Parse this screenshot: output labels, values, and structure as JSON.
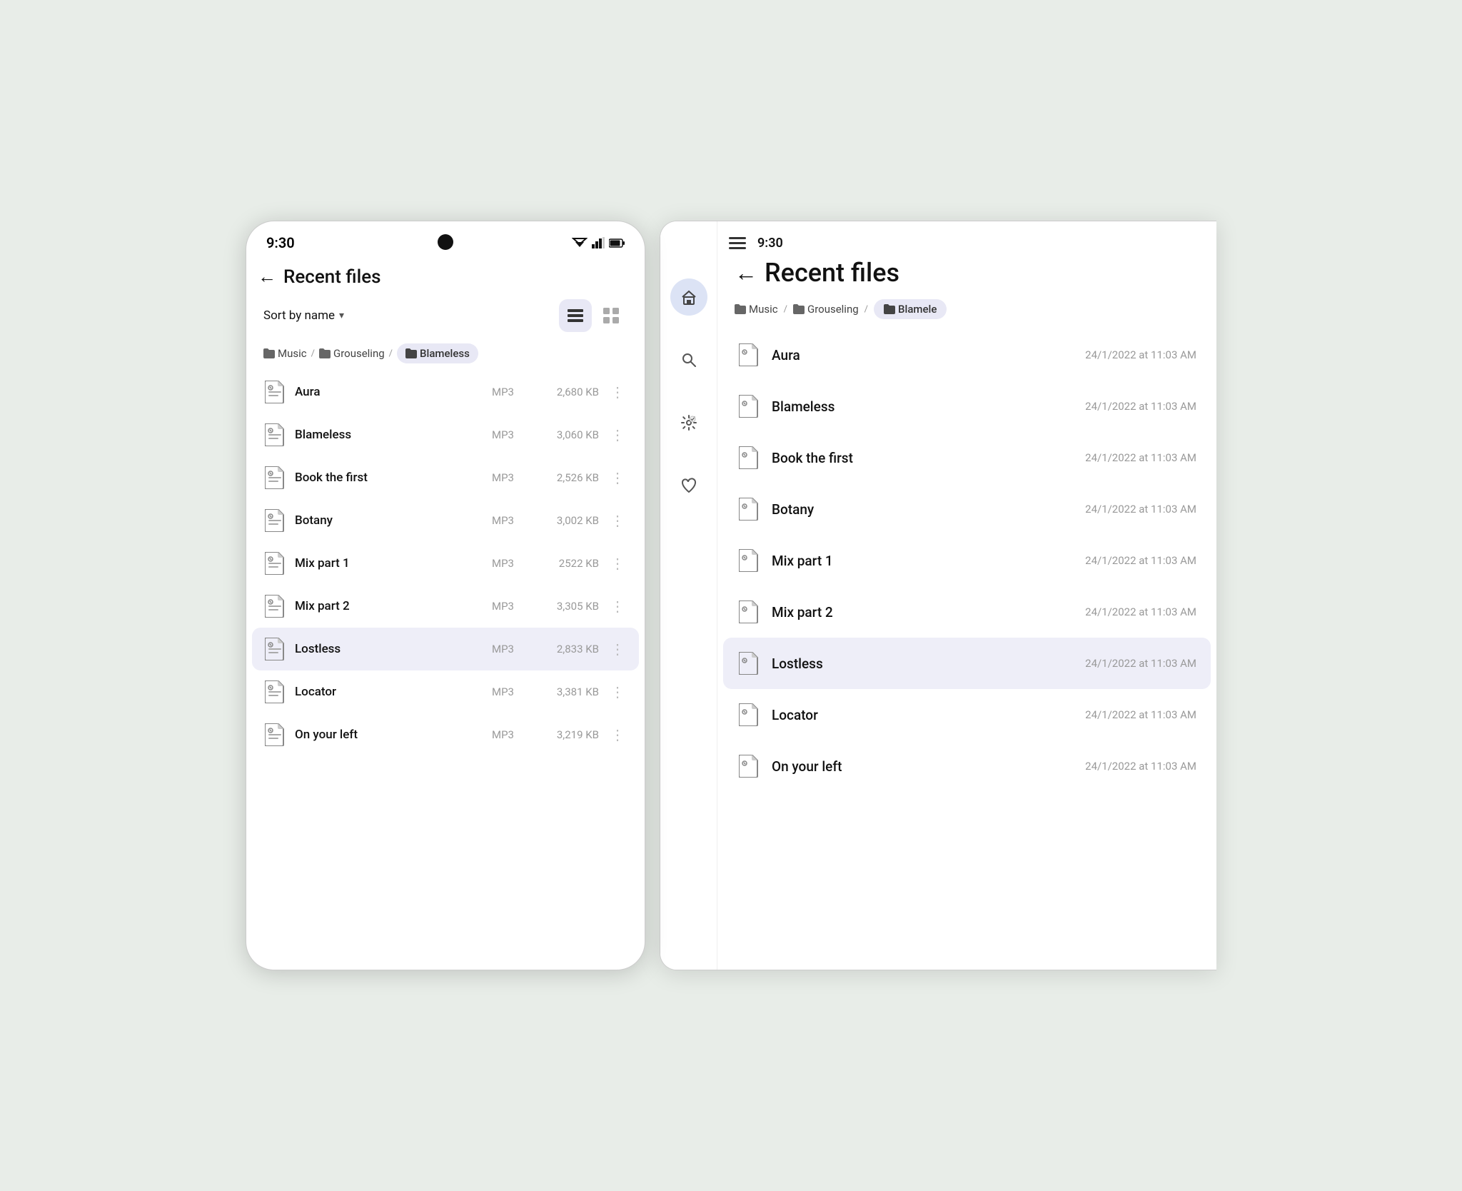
{
  "left_phone": {
    "status_time": "9:30",
    "title": "Recent files",
    "back_label": "←",
    "sort_label": "Sort by name",
    "view_list_active": true,
    "breadcrumbs": [
      {
        "label": "Music",
        "icon": "folder"
      },
      {
        "label": "Grouseling",
        "icon": "folder"
      },
      {
        "label": "Blameless",
        "icon": "folder",
        "active": true
      }
    ],
    "files": [
      {
        "name": "Aura",
        "type": "MP3",
        "size": "2,680 KB",
        "selected": false
      },
      {
        "name": "Blameless",
        "type": "MP3",
        "size": "3,060 KB",
        "selected": false
      },
      {
        "name": "Book the first",
        "type": "MP3",
        "size": "2,526 KB",
        "selected": false
      },
      {
        "name": "Botany",
        "type": "MP3",
        "size": "3,002 KB",
        "selected": false
      },
      {
        "name": "Mix part 1",
        "type": "MP3",
        "size": "2522 KB",
        "selected": false
      },
      {
        "name": "Mix part 2",
        "type": "MP3",
        "size": "3,305 KB",
        "selected": false
      },
      {
        "name": "Lostless",
        "type": "MP3",
        "size": "2,833 KB",
        "selected": true
      },
      {
        "name": "Locator",
        "type": "MP3",
        "size": "3,381 KB",
        "selected": false
      },
      {
        "name": "On your left",
        "type": "MP3",
        "size": "3,219 KB",
        "selected": false
      }
    ]
  },
  "right_tablet": {
    "status_time": "9:30",
    "title": "Recent files",
    "back_label": "←",
    "breadcrumbs": [
      {
        "label": "Music",
        "icon": "folder"
      },
      {
        "label": "Grouseling",
        "icon": "folder"
      },
      {
        "label": "Blamele",
        "icon": "folder",
        "active": true
      }
    ],
    "files": [
      {
        "name": "Aura",
        "date": "24/1/2022 at 11:03 AM",
        "selected": false
      },
      {
        "name": "Blameless",
        "date": "24/1/2022 at 11:03 AM",
        "selected": false
      },
      {
        "name": "Book the first",
        "date": "24/1/2022 at 11:03 AM",
        "selected": false
      },
      {
        "name": "Botany",
        "date": "24/1/2022 at 11:03 AM",
        "selected": false
      },
      {
        "name": "Mix part 1",
        "date": "24/1/2022 at 11:03 AM",
        "selected": false
      },
      {
        "name": "Mix part 2",
        "date": "24/1/2022 at 11:03 AM",
        "selected": false
      },
      {
        "name": "Lostless",
        "date": "24/1/2022 at 11:03 AM",
        "selected": true
      },
      {
        "name": "Locator",
        "date": "24/1/2022 at 11:03 AM",
        "selected": false
      },
      {
        "name": "On your left",
        "date": "24/1/2022 at 11:03 AM",
        "selected": false
      }
    ],
    "sidebar_icons": [
      "home",
      "search",
      "settings",
      "favorite"
    ]
  }
}
